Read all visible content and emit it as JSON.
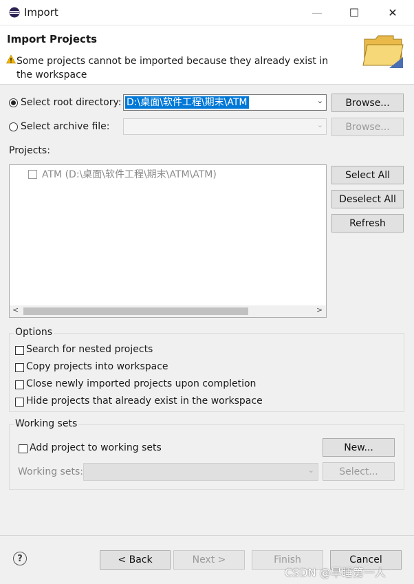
{
  "window": {
    "title": "Import",
    "controls": {
      "minimize": "—",
      "maximize": "☐",
      "close": "✕"
    }
  },
  "header": {
    "title": "Import Projects",
    "message": "Some projects cannot be imported because they already exist in the workspace"
  },
  "source": {
    "root_dir_label": "Select root directory:",
    "root_dir_value": "D:\\桌面\\软件工程\\期末\\ATM",
    "archive_label": "Select archive file:",
    "browse_label": "Browse...",
    "browse_disabled_label": "Browse..."
  },
  "projects": {
    "label": "Projects:",
    "items": [
      {
        "label": "ATM (D:\\桌面\\软件工程\\期末\\ATM\\ATM)",
        "checked": false
      }
    ],
    "select_all": "Select All",
    "deselect_all": "Deselect All",
    "refresh": "Refresh"
  },
  "options": {
    "title": "Options",
    "items": [
      {
        "label": "Search for nested projects",
        "checked": false
      },
      {
        "label": "Copy projects into workspace",
        "checked": false
      },
      {
        "label": "Close newly imported projects upon completion",
        "checked": false
      },
      {
        "label": "Hide projects that already exist in the workspace",
        "checked": false
      }
    ]
  },
  "working_sets": {
    "title": "Working sets",
    "add_label": "Add project to working sets",
    "new_button": "New...",
    "sets_label": "Working sets:",
    "select_button": "Select..."
  },
  "footer": {
    "help": "?",
    "back": "< Back",
    "next": "Next >",
    "finish": "Finish",
    "cancel": "Cancel"
  },
  "watermark": "CSDN @早睡第一人",
  "colors": {
    "accent_selection": "#0078d7",
    "warning": "#f0b400",
    "folder": "#f2cc5c"
  }
}
